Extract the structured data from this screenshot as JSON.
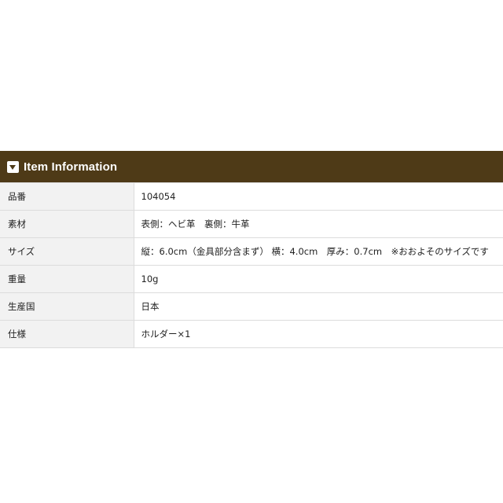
{
  "section": {
    "title": "Item Information",
    "icon": "caret-down-square-icon"
  },
  "rows": [
    {
      "label": "品番",
      "value": "104054"
    },
    {
      "label": "素材",
      "value": "表側：ヘビ革　裏側：牛革"
    },
    {
      "label": "サイズ",
      "value": "縦：6.0cm（金具部分含まず）  横：4.0cm　厚み：0.7cm　※おおよそのサイズです"
    },
    {
      "label": "重量",
      "value": "10g"
    },
    {
      "label": "生産国",
      "value": "日本"
    },
    {
      "label": "仕様",
      "value": "ホルダー×1"
    }
  ],
  "colors": {
    "header_bg": "#4e3a17",
    "label_bg": "#f2f2f2",
    "border": "#dcdcdc"
  }
}
